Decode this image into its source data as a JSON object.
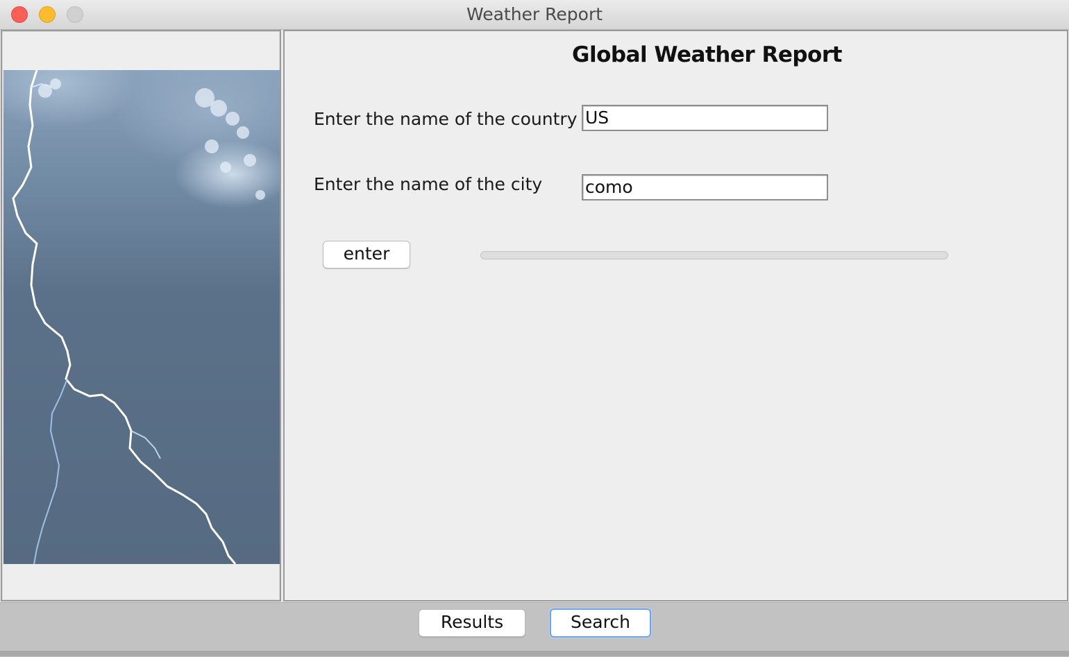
{
  "window": {
    "title": "Weather Report"
  },
  "form": {
    "heading": "Global Weather Report",
    "country_label": "Enter the name of the country",
    "country_value": "US",
    "city_label": "Enter the name of the city",
    "city_value": "como",
    "enter_label": "enter",
    "progress_fraction": 0
  },
  "left_panel": {
    "image": "storm-lightning-image"
  },
  "tabs": {
    "results_label": "Results",
    "search_label": "Search",
    "selected": "Search"
  },
  "colors": {
    "close": "#fc5f57",
    "minimize": "#fdbc2e",
    "zoom_disabled": "#d0d0d0",
    "focus_ring": "#6fa3e8"
  }
}
